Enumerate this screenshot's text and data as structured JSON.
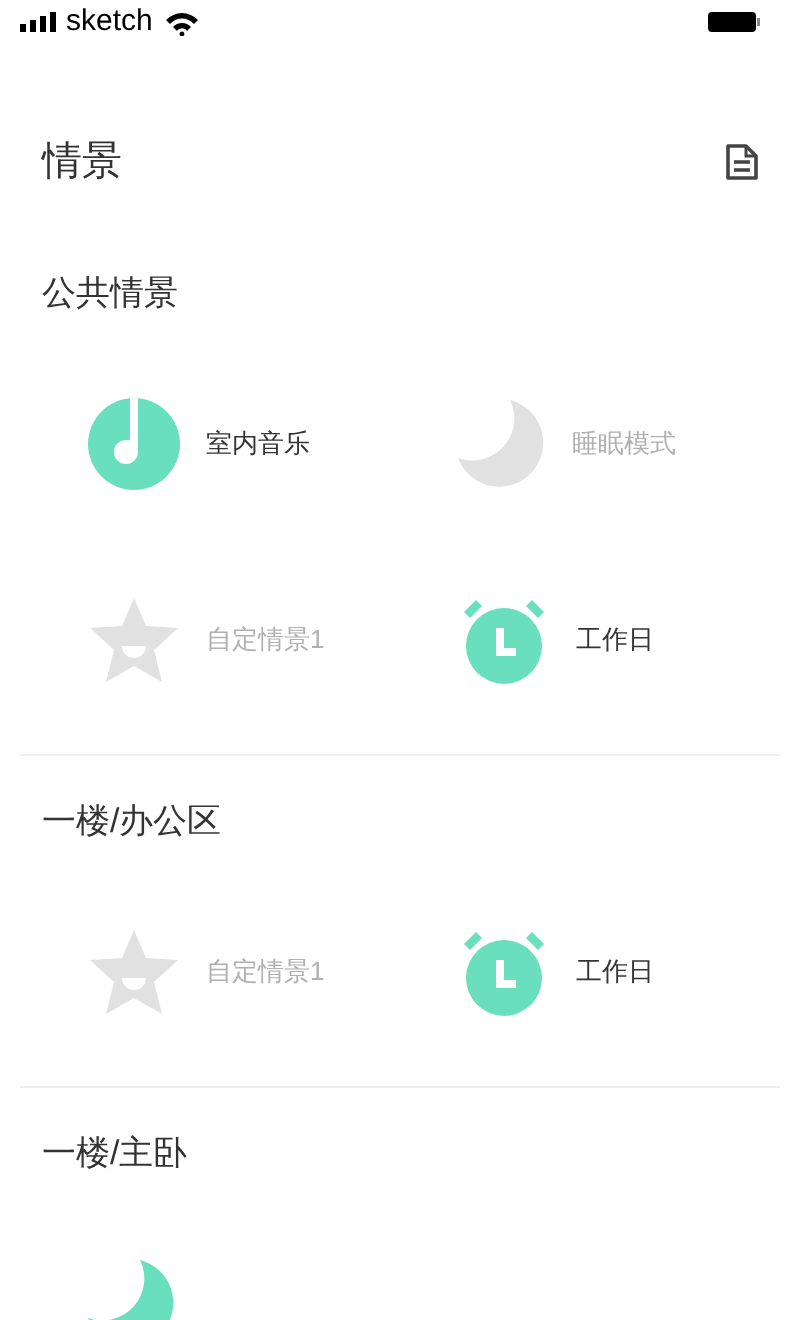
{
  "status_bar": {
    "carrier": "sketch"
  },
  "header": {
    "title": "情景"
  },
  "sections": [
    {
      "title": "公共情景",
      "items": [
        {
          "kind": "music",
          "label": "室内音乐",
          "active": true
        },
        {
          "kind": "moon",
          "label": "睡眠模式",
          "active": false
        },
        {
          "kind": "star",
          "label": "自定情景1",
          "active": false
        },
        {
          "kind": "alarm",
          "label": "工作日",
          "active": true
        }
      ]
    },
    {
      "title": "一楼/办公区",
      "items": [
        {
          "kind": "star",
          "label": "自定情景1",
          "active": false
        },
        {
          "kind": "alarm",
          "label": "工作日",
          "active": true
        }
      ]
    },
    {
      "title": "一楼/主卧",
      "items": [
        {
          "kind": "moon",
          "active": true
        }
      ]
    }
  ]
}
